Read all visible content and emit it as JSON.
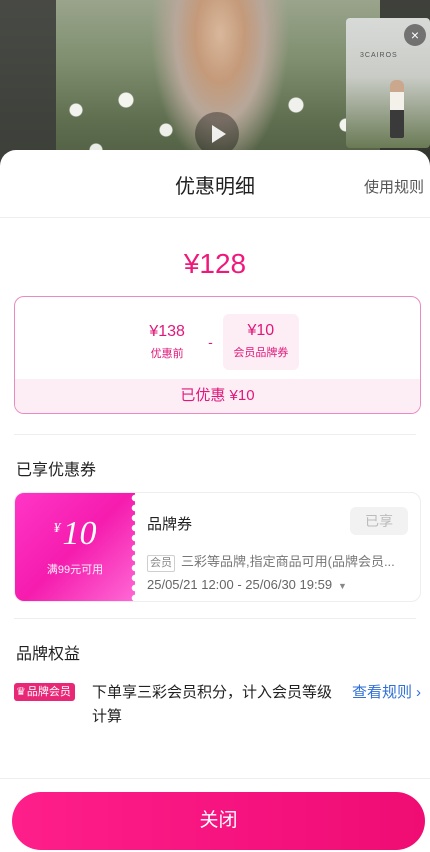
{
  "sheet": {
    "title": "优惠明细",
    "rules_link": "使用规则"
  },
  "summary": {
    "final_price": "¥128",
    "original_price_value": "¥138",
    "original_price_label": "优惠前",
    "minus": "-",
    "coupon_value": "¥10",
    "coupon_label": "会员品牌券",
    "saved_text": "已优惠 ¥10"
  },
  "coupons_section": {
    "title": "已享优惠券",
    "coupon": {
      "currency": "¥",
      "amount": "10",
      "condition": "满99元可用",
      "name": "品牌券",
      "status": "已享",
      "tag": "会员",
      "description": "三彩等品牌,指定商品可用(品牌会员...",
      "validity": "25/05/21 12:00 - 25/06/30 19:59",
      "caret_icon": "▼"
    }
  },
  "benefits_section": {
    "title": "品牌权益",
    "badge": "品牌会员",
    "crown_icon": "♛",
    "text": "下单享三彩会员积分，计入会员等级计算",
    "link": "查看规则",
    "chevron_icon": "›"
  },
  "footer": {
    "close_label": "关闭"
  },
  "video": {
    "mini_sign": "3CAIROS",
    "close_icon": "×"
  },
  "colors": {
    "accent": "#f0187a",
    "link": "#2f6fd6"
  }
}
